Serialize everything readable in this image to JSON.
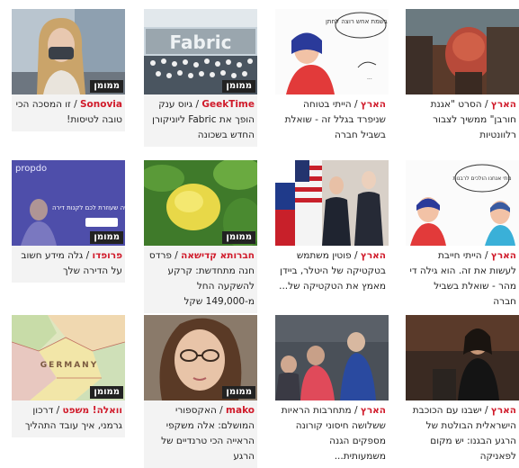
{
  "badge_label": "ממומן",
  "colors": {
    "source_red": "#d01a2a"
  },
  "cards": [
    {
      "source": "הארץ",
      "title": "הסרט \"אגנת חורבן\" ממשיך לצבור רלוונטיות",
      "sponsored": false
    },
    {
      "source": "הארץ",
      "title": "הייתי בטוחה שניפרד בגלל זה - שואלת בשביל חברה",
      "sponsored": false
    },
    {
      "source": "GeekTime",
      "title": "גיוס ענק הופך את Fabric ליוניקורן החדש בשכונה",
      "sponsored": true
    },
    {
      "source": "Sonovia",
      "title": "זו המסכה הכי טובה לטיסות!",
      "sponsored": true
    },
    {
      "source": "הארץ",
      "title": "הייתי חייבת לעשות את זה. הוא גילה די מהר - שואלת בשביל חברה",
      "sponsored": false
    },
    {
      "source": "הארץ",
      "title": "פוטין משתמש בטקטיקה של היטלר, ביידן מאמץ את הטקטיקה של...",
      "sponsored": false
    },
    {
      "source": "חברותא קדישאה",
      "title": "פרדס חנה מתחדשת: קרקע להשקעה החל מ-149,000 שקל",
      "sponsored": true
    },
    {
      "source": "פרופדו",
      "title": "גלה מידע חשוב על הדירה שלך",
      "sponsored": true
    },
    {
      "source": "הארץ",
      "title": "ישבנו עם הכוכבת הישראלית הבולטת של הרגע הבגנו: יש מקום לפאניקה",
      "sponsored": false
    },
    {
      "source": "הארץ",
      "title": "מתחרבות הראיות ששלושה חיסוני קורונה מספקים הגנה משמעותית...",
      "sponsored": false
    },
    {
      "source": "mako",
      "title": "האקספורי המושלם: אלה משקפי הראייה הכי טרנדיים של הרגע",
      "sponsored": true
    },
    {
      "source": "וואלה! משפט",
      "title": "דרכון גרמני, איך עובד התהליך",
      "sponsored": true
    }
  ],
  "images": {
    "card3_text": "Fabric",
    "card5_bubble": "מתי אנחנו הולכים לרבנות",
    "card7_text": "האפליקציה שעוזרת לכם לקנות דירה",
    "card7_logo": "propdo",
    "card2_bubble": "זה בשמת אחש רוצה לחתן",
    "card11_label": "GERMANY"
  }
}
